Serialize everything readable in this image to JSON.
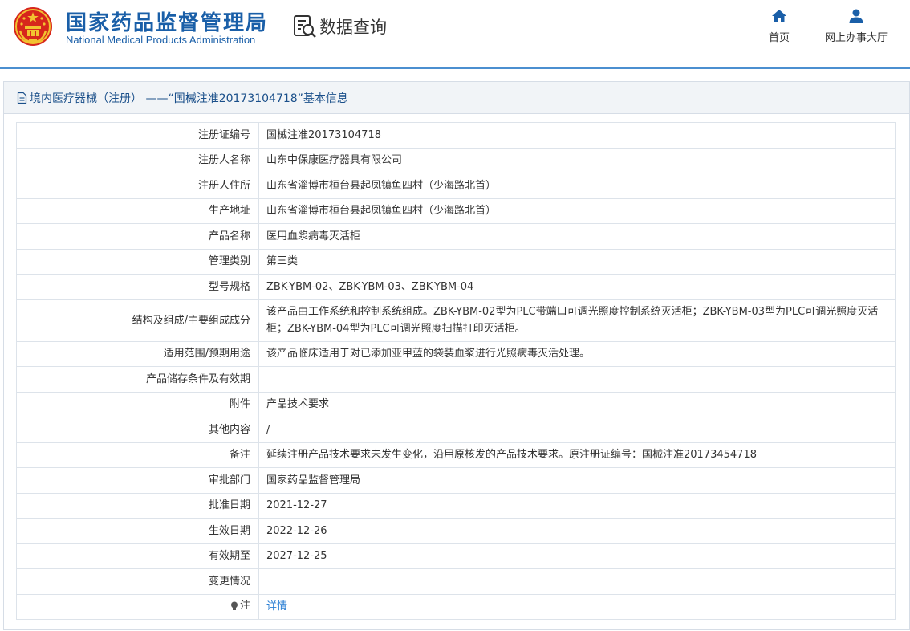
{
  "header": {
    "org_name_cn": "国家药品监督管理局",
    "org_name_en": "National Medical Products Administration",
    "query_label": "数据查询",
    "nav": {
      "home_label": "首页",
      "service_label": "网上办事大厅"
    }
  },
  "panel": {
    "title": "境内医疗器械（注册） ——“国械注准20173104718”基本信息"
  },
  "fields": [
    {
      "label": "注册证编号",
      "value": "国械注准20173104718"
    },
    {
      "label": "注册人名称",
      "value": "山东中保康医疗器具有限公司"
    },
    {
      "label": "注册人住所",
      "value": "山东省淄博市桓台县起凤镇鱼四村（少海路北首）"
    },
    {
      "label": "生产地址",
      "value": "山东省淄博市桓台县起凤镇鱼四村（少海路北首）"
    },
    {
      "label": "产品名称",
      "value": "医用血浆病毒灭活柜"
    },
    {
      "label": "管理类别",
      "value": "第三类"
    },
    {
      "label": "型号规格",
      "value": "ZBK-YBM-02、ZBK-YBM-03、ZBK-YBM-04"
    },
    {
      "label": "结构及组成/主要组成成分",
      "value": "该产品由工作系统和控制系统组成。ZBK-YBM-02型为PLC带端口可调光照度控制系统灭活柜；ZBK-YBM-03型为PLC可调光照度灭活柜；ZBK-YBM-04型为PLC可调光照度扫描打印灭活柜。"
    },
    {
      "label": "适用范围/预期用途",
      "value": "该产品临床适用于对已添加亚甲蓝的袋装血浆进行光照病毒灭活处理。"
    },
    {
      "label": "产品储存条件及有效期",
      "value": ""
    },
    {
      "label": "附件",
      "value": "产品技术要求"
    },
    {
      "label": "其他内容",
      "value": "/"
    },
    {
      "label": "备注",
      "value": "延续注册产品技术要求未发生变化，沿用原核发的产品技术要求。原注册证编号：国械注准20173454718"
    },
    {
      "label": "审批部门",
      "value": "国家药品监督管理局"
    },
    {
      "label": "批准日期",
      "value": "2021-12-27"
    },
    {
      "label": "生效日期",
      "value": "2022-12-26"
    },
    {
      "label": "有效期至",
      "value": "2027-12-25"
    },
    {
      "label": "变更情况",
      "value": ""
    },
    {
      "label": "注",
      "value": "详情"
    }
  ],
  "icons": {
    "emblem": "national-emblem-icon",
    "query": "data-query-icon",
    "home": "home-icon",
    "service": "user-icon",
    "title": "document-icon",
    "note": "bulb-icon"
  },
  "colors": {
    "brand": "#1a5fa8",
    "header_rule": "#4b8fd0",
    "link": "#2b7fd4",
    "panel_title_bg": "#f1f4f7",
    "emblem_red": "#d7261c",
    "emblem_gold": "#f2c230"
  }
}
